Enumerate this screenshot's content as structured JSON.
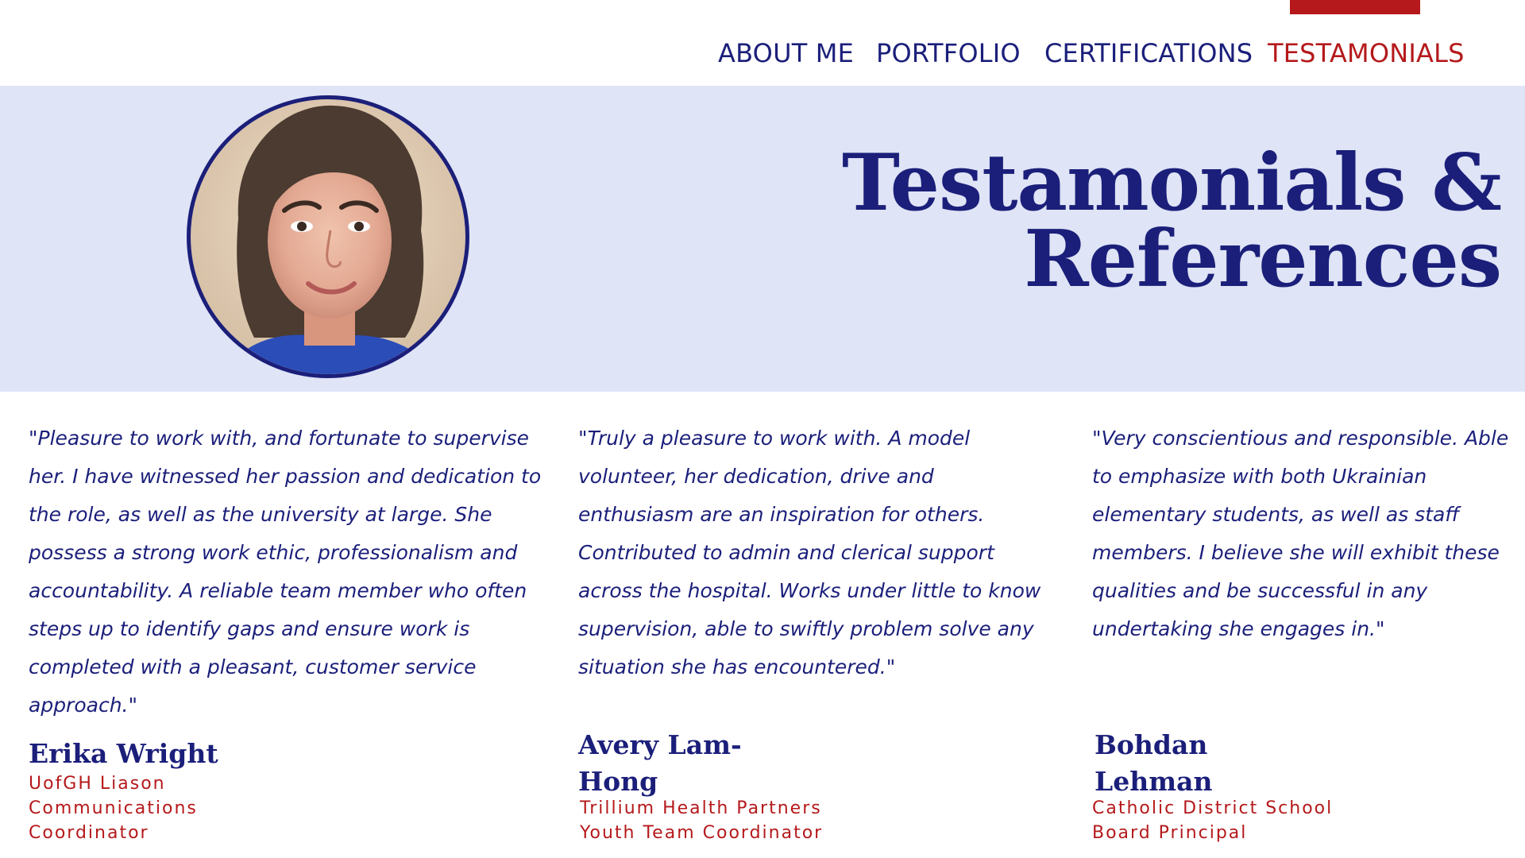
{
  "nav": {
    "items": [
      {
        "label": "ABOUT ME",
        "active": false
      },
      {
        "label": "PORTFOLIO",
        "active": false
      },
      {
        "label": "CERTIFICATIONS",
        "active": false
      },
      {
        "label": "TESTAMONIALS",
        "active": true
      }
    ],
    "accent_color": "#b5191b",
    "text_color": "#1b1f7a"
  },
  "hero": {
    "title_line1": "Testamonials &",
    "title_line2": "References",
    "background": "#dfe4f6",
    "avatar": "profile-photo"
  },
  "testimonials": [
    {
      "quote": "\"Pleasure to work with, and fortunate to supervise her. I have witnessed her passion and dedication to the role, as well as the university at large. She possess a strong work ethic, professionalism and accountability. A reliable team member who often steps up to identify gaps and ensure work is completed with a pleasant, customer service approach.\"",
      "name": "Erika Wright",
      "role_line1": "UofGH Liason",
      "role_line2": "Communications",
      "role_line3": "Coordinator"
    },
    {
      "quote": "\"Truly a pleasure to work with. A model volunteer, her dedication, drive and enthusiasm are an inspiration for others. Contributed to admin and clerical support across the hospital. Works under little to know supervision, able to swiftly problem solve any situation she has encountered.\"",
      "name_line1": "Avery Lam-",
      "name_line2": "Hong",
      "role_line1": "Trillium Health Partners",
      "role_line2": "Youth Team Coordinator"
    },
    {
      "quote": "\"Very conscientious and responsible. Able to emphasize with both Ukrainian elementary students, as well as staff members. I believe she will exhibit these qualities and be successful in any undertaking she engages in.\"",
      "name_line1": "Bohdan",
      "name_line2": "Lehman",
      "role_line1": "Catholic District School",
      "role_line2": "Board Principal"
    }
  ]
}
